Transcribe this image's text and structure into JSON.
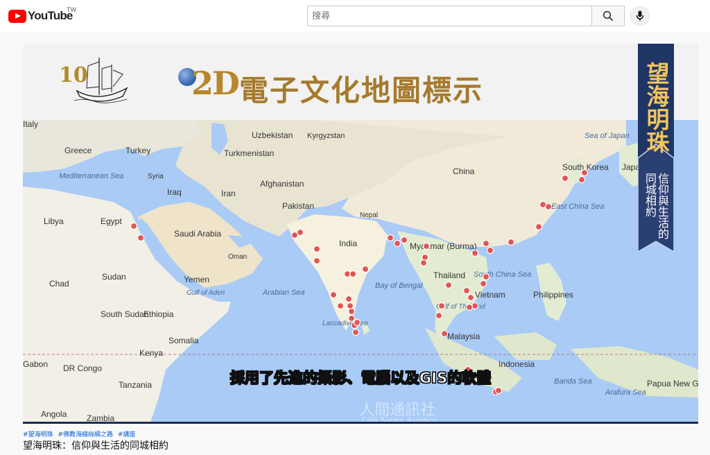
{
  "header": {
    "logo_text": "YouTube",
    "region": "TW",
    "search_placeholder": "搜尋"
  },
  "video": {
    "banner": {
      "anniversary": "10",
      "badge_2d": "2D",
      "title": "電子文化地圖標示"
    },
    "ribbon": {
      "title": "望海明珠",
      "subtitle": "信仰與生活的同城相約"
    },
    "subtitle": "採用了先進的攝影、電腦以及GIS的軟體",
    "watermark_en": "Life News Agency",
    "watermark_cn": "人間通訊社"
  },
  "map_labels": [
    {
      "text": "Italy",
      "kind": "land"
    },
    {
      "text": "Uzbekistan",
      "kind": "land"
    },
    {
      "text": "Kyrgyzstan",
      "kind": "land"
    },
    {
      "text": "Greece",
      "kind": "land"
    },
    {
      "text": "Turkey",
      "kind": "land"
    },
    {
      "text": "Turkmenistan",
      "kind": "land"
    },
    {
      "text": "Syria",
      "kind": "land"
    },
    {
      "text": "China",
      "kind": "land"
    },
    {
      "text": "Mediterranean Sea",
      "kind": "sea"
    },
    {
      "text": "Iraq",
      "kind": "land"
    },
    {
      "text": "Iran",
      "kind": "land"
    },
    {
      "text": "Afghanistan",
      "kind": "land"
    },
    {
      "text": "South Korea",
      "kind": "land"
    },
    {
      "text": "Japan",
      "kind": "land"
    },
    {
      "text": "Sea of Japan",
      "kind": "sea"
    },
    {
      "text": "Pakistan",
      "kind": "land"
    },
    {
      "text": "Libya",
      "kind": "land"
    },
    {
      "text": "Egypt",
      "kind": "land"
    },
    {
      "text": "Saudi Arabia",
      "kind": "land"
    },
    {
      "text": "Nepal",
      "kind": "land"
    },
    {
      "text": "East China Sea",
      "kind": "sea"
    },
    {
      "text": "India",
      "kind": "land"
    },
    {
      "text": "Myanmar (Burma)",
      "kind": "land"
    },
    {
      "text": "Oman",
      "kind": "land"
    },
    {
      "text": "Chad",
      "kind": "land"
    },
    {
      "text": "Sudan",
      "kind": "land"
    },
    {
      "text": "Yemen",
      "kind": "land"
    },
    {
      "text": "Thailand",
      "kind": "land"
    },
    {
      "text": "South China Sea",
      "kind": "sea"
    },
    {
      "text": "Arabian Sea",
      "kind": "sea"
    },
    {
      "text": "Bay of Bengal",
      "kind": "sea"
    },
    {
      "text": "Gulf of Aden",
      "kind": "sea"
    },
    {
      "text": "Vietnam",
      "kind": "land"
    },
    {
      "text": "Philippines",
      "kind": "land"
    },
    {
      "text": "Gulf of Thailand",
      "kind": "sea"
    },
    {
      "text": "South Sudan",
      "kind": "land"
    },
    {
      "text": "Ethiopia",
      "kind": "land"
    },
    {
      "text": "Laccadive Sea",
      "kind": "sea"
    },
    {
      "text": "Somalia",
      "kind": "land"
    },
    {
      "text": "Malaysia",
      "kind": "land"
    },
    {
      "text": "Kenya",
      "kind": "land"
    },
    {
      "text": "Gabon",
      "kind": "land"
    },
    {
      "text": "Indonesia",
      "kind": "land"
    },
    {
      "text": "DR Congo",
      "kind": "land"
    },
    {
      "text": "Banda Sea",
      "kind": "sea"
    },
    {
      "text": "Papua New Guinea",
      "kind": "land"
    },
    {
      "text": "Tanzania",
      "kind": "land"
    },
    {
      "text": "Arafura Sea",
      "kind": "sea"
    },
    {
      "text": "Angola",
      "kind": "land"
    },
    {
      "text": "Zambia",
      "kind": "land"
    }
  ],
  "meta": {
    "tags": [
      "#望海明珠",
      "#佛教海線絲綢之路",
      "#講座"
    ],
    "title": "望海明珠：信仰與生活的同城相約"
  },
  "colors": {
    "marker": "#e05555",
    "ribbon": "#1e3566",
    "gold": "#b8872b"
  }
}
